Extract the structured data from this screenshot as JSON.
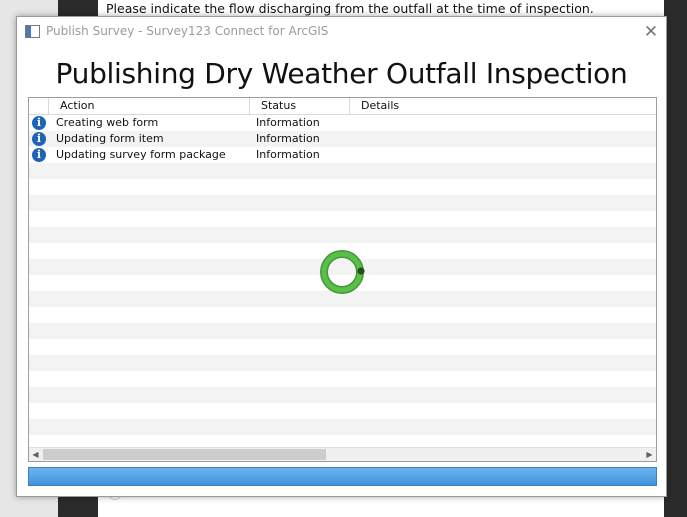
{
  "background": {
    "question_text": "Please indicate the flow discharging from the outfall at the time of inspection."
  },
  "dialog": {
    "title": "Publish Survey - Survey123 Connect for ArcGIS",
    "close_glyph": "✕",
    "heading": "Publishing Dry Weather Outfall Inspection"
  },
  "table": {
    "columns": {
      "action": "Action",
      "status": "Status",
      "details": "Details"
    },
    "rows": [
      {
        "icon": "info-icon",
        "action": "Creating web form",
        "status": "Information",
        "details": ""
      },
      {
        "icon": "info-icon",
        "action": "Updating form item",
        "status": "Information",
        "details": ""
      },
      {
        "icon": "info-icon",
        "action": "Updating survey form package",
        "status": "Information",
        "details": ""
      }
    ],
    "scroll_left_glyph": "◀",
    "scroll_right_glyph": "▶"
  },
  "progress": {
    "percent": 100,
    "color": "#4a9de4"
  },
  "spinner": {
    "color": "#4caf3a"
  }
}
